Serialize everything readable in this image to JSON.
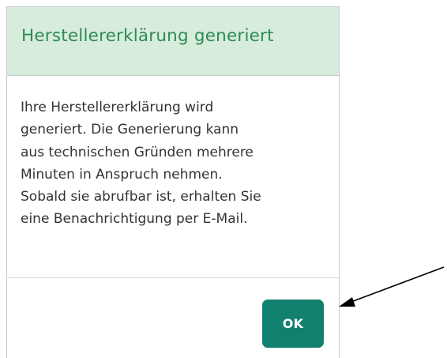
{
  "dialog": {
    "title": "Herstellererklärung generiert",
    "body_lines": [
      "Ihre Herstellererklärung wird",
      "generiert. Die Generierung kann",
      "aus technischen Gründen mehrere",
      "Minuten in Anspruch nehmen.",
      "Sobald sie abrufbar ist, erhalten Sie",
      "eine Benachrichtigung per E-Mail."
    ],
    "ok_label": "OK"
  },
  "colors": {
    "header_background": "#d7ecdb",
    "title_text": "#2e8b57",
    "button_background": "#12806f",
    "button_text": "#ffffff",
    "annotation_arrow": "#000000"
  },
  "annotation": {
    "icon": "arrow-pointer-icon"
  }
}
